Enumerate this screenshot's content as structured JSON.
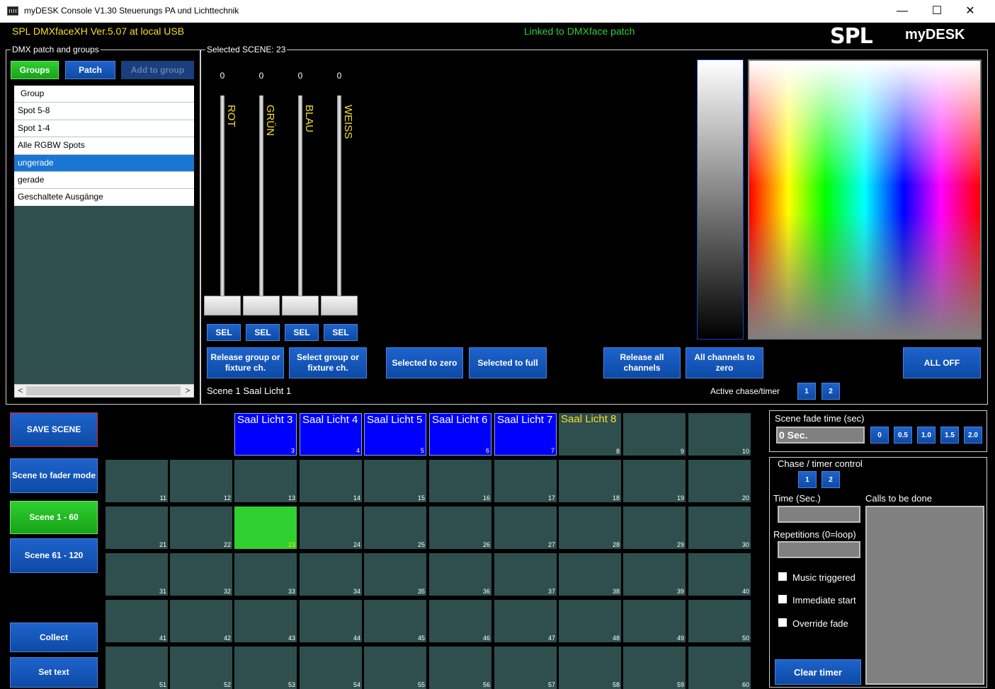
{
  "window": {
    "title": "myDESK Console V1.30  Steuerungs PA und Lichttechnik",
    "minimize": "—",
    "maximize": "☐",
    "close": "✕"
  },
  "header": {
    "device": "SPL DMXfaceXH Ver.5.07 at local USB",
    "link_status": "Linked to DMXface patch",
    "logo": "SPL",
    "brand": "myDESK"
  },
  "left_panel": {
    "legend": "DMX patch and groups",
    "tabs": {
      "groups": "Groups",
      "patch": "Patch",
      "add": "Add to group"
    },
    "list_header": "Group",
    "items": [
      "Spot 5-8",
      "Spot 1-4",
      "Alle RGBW Spots",
      "ungerade",
      "gerade",
      "Geschaltete Ausgänge"
    ],
    "selected_item": "ungerade",
    "scroll_left": "<",
    "scroll_right": ">"
  },
  "scene_panel": {
    "legend": "Selected SCENE: 23",
    "faders": [
      {
        "label": "ROT",
        "value": "0",
        "sel": "SEL"
      },
      {
        "label": "GRÜN",
        "value": "0",
        "sel": "SEL"
      },
      {
        "label": "BLAU",
        "value": "0",
        "sel": "SEL"
      },
      {
        "label": "WEISS",
        "value": "0",
        "sel": "SEL"
      }
    ],
    "buttons": {
      "release_group": "Release group or fixture ch.",
      "select_group": "Select group or fixture ch.",
      "sel_zero": "Selected to zero",
      "sel_full": "Selected to full",
      "release_all": "Release all channels",
      "all_zero": "All channels to zero",
      "all_off": "ALL OFF"
    },
    "status": "Scene 1  Saal Licht 1",
    "active_chase_label": "Active chase/timer",
    "chase_buttons": [
      "1",
      "2"
    ]
  },
  "side_buttons": {
    "save": "SAVE SCENE",
    "fader_mode": "Scene to fader mode",
    "bank1": "Scene 1 - 60",
    "bank2": "Scene 61 - 120",
    "collect": "Collect",
    "set_text": "Set text"
  },
  "scenes": {
    "selected": 23,
    "named": {
      "3": "Saal Licht 3",
      "4": "Saal Licht 4",
      "5": "Saal Licht 5",
      "6": "Saal Licht 6",
      "7": "Saal Licht 7",
      "8": "Saal Licht 8"
    }
  },
  "fade": {
    "legend": "Scene fade time (sec)",
    "value": "0 Sec.",
    "presets": [
      "0",
      "0.5",
      "1.0",
      "1.5",
      "2.0"
    ]
  },
  "chase": {
    "legend": "Chase / timer control",
    "buttons": [
      "1",
      "2"
    ],
    "time_label": "Time (Sec.)",
    "calls_label": "Calls to be done",
    "reps_label": "Repetitions (0=loop)",
    "music": "Music triggered",
    "immediate": "Immediate start",
    "override": "Override fade",
    "clear": "Clear timer"
  },
  "colors": {
    "accent_blue": "#1e63cc",
    "panel": "#2f4f4f",
    "active_green": "#2fd02f",
    "scene_blue": "#0000ff",
    "header_yellow": "#f5e11b"
  }
}
